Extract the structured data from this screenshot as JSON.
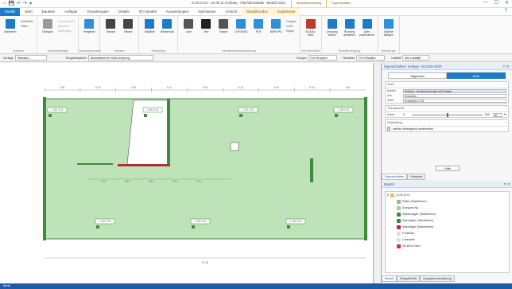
{
  "app": {
    "title": "2.OG.D.01 - 22 09 11 Archbau - Flachdeckstatik - Modell 2022",
    "context_tabs": [
      "Modellbearbeitung",
      "Eigenschaften"
    ]
  },
  "quick_access": [
    "⌂",
    "💾",
    "↶",
    "↷",
    "▾"
  ],
  "window_controls": [
    "—",
    "☐",
    "✕"
  ],
  "tabs": [
    {
      "label": "Modell",
      "active": true
    },
    {
      "label": "Start"
    },
    {
      "label": "Bauteile"
    },
    {
      "label": "Auflager"
    },
    {
      "label": "Einwirkungen"
    },
    {
      "label": "Details"
    },
    {
      "label": "IFC-Modell"
    },
    {
      "label": "Auswertungen"
    },
    {
      "label": "Nachweise"
    },
    {
      "label": "Ansicht"
    },
    {
      "label": "Modellmodus",
      "ctx": true
    },
    {
      "label": "Ergebnisse",
      "ctx": true
    }
  ],
  "help": "?",
  "ribbon": {
    "groups": [
      {
        "name": "Auswahl",
        "buttons": [
          {
            "label": "Markieren",
            "color": "#1e7bc8"
          }
        ],
        "small": [
          "Selektierte",
          "Filtern"
        ]
      },
      {
        "name": "Zwischenablage",
        "buttons": [
          {
            "label": "Einfügen",
            "color": "#9a9a9a"
          }
        ],
        "small": [
          "Ausschneiden",
          "Kopieren",
          "Übertragen"
        ]
      },
      {
        "name": "Ursprungsmodell",
        "buttons": [
          {
            "label": "Freigeben",
            "color": "#2f8fd8"
          }
        ],
        "small": []
      },
      {
        "name": "Messen",
        "buttons": [
          {
            "label": "Strecke",
            "color": "#444"
          },
          {
            "label": "Winkel",
            "color": "#444"
          }
        ],
        "small": []
      },
      {
        "name": "Bemaßung",
        "buttons": [
          {
            "label": "Maßlinie",
            "color": "#1e7bc8"
          },
          {
            "label": "Winkelmaß",
            "color": "#1e7bc8"
          }
        ],
        "small": []
      },
      {
        "name": "Arbeitsbereichsdarstellung",
        "buttons": [
          {
            "label": "Linie",
            "color": "#555"
          },
          {
            "label": "Text",
            "color": "#222"
          },
          {
            "label": "Raster",
            "color": "#555"
          },
          {
            "label": "DXF/DWG",
            "color": "#2f8fd8"
          },
          {
            "label": "PDF",
            "color": "#2f8fd8"
          },
          {
            "label": "BMP/JPG",
            "color": "#2f8fd8"
          }
        ],
        "small": [
          "Polygon",
          "Kreis",
          "Bogen"
        ]
      },
      {
        "name": "mb WorkSuite",
        "buttons": [
          {
            "label": "ViCADo-Sicht",
            "color": "#c0392b"
          }
        ],
        "small": []
      },
      {
        "name": "Modellerzeugung",
        "buttons": [
          {
            "label": "Ursprung setzen",
            "color": "#1e7bc8"
          },
          {
            "label": "Richtung definieren",
            "color": "#1e7bc8"
          },
          {
            "label": "Alles positionieren",
            "color": "#1e7bc8"
          }
        ],
        "small": []
      },
      {
        "name": "Werkzeuge",
        "buttons": [
          {
            "label": "Objekte ablegen",
            "color": "#2f8fd8"
          }
        ],
        "small": []
      }
    ]
  },
  "toolbar": {
    "vorlage_label": "Vorlage",
    "vorlage_value": "Standard",
    "eingabe_label": "Eingabesystem",
    "eingabe_value": "Automatisch im Sicht-Ursprung",
    "gruppe_label": "Gruppe",
    "gruppe_value": "Frei Gruppen",
    "situation_label": "Situation",
    "situation_value": "Frei Situation",
    "lastfall_label": "Lastfall",
    "lastfall_value": "alle Lastfälle"
  },
  "props": {
    "title": "Eigenschaften: Vorlage 'ViCADo-Sicht'",
    "tabs": [
      "Allgemein",
      "Sicht"
    ],
    "sicht_header": "Sicht",
    "rows": [
      {
        "k": "Modell",
        "v": "Rohbau - Architekturmodell mit Rohbau"
      },
      {
        "k": "Zus.",
        "v": "Grundriss"
      },
      {
        "k": "Sicht",
        "v": "Draufsicht 2.OG"
      }
    ],
    "transparenz_header": "Transparenz",
    "anteil_label": "Anteil",
    "anteil_min": "0",
    "anteil_max": "100",
    "anteil_val": "50",
    "anteil_unit": "%",
    "darstellung_header": "Darstellung",
    "hintergrund": "weißen Hintergrund ausblenden",
    "hilfe": "Hilfe",
    "bottom_tabs": [
      "Eigenschaften",
      "Hinweise"
    ]
  },
  "model": {
    "title": "Modell",
    "root": "2.OG.D.01",
    "items": [
      {
        "label": "Platte (Stahlbeton)",
        "color": "#7fc97f"
      },
      {
        "label": "Aussparung",
        "color": "#bbb"
      },
      {
        "label": "Stützenlager (Stahlbeton)",
        "color": "#3d8b3d"
      },
      {
        "label": "Wandlager (Stahlbeton)",
        "color": "#3d8b3d"
      },
      {
        "label": "Wandlager (Mauerwerk)",
        "color": "#b03030"
      },
      {
        "label": "Punktlast",
        "color": "#ddd"
      },
      {
        "label": "Linienlast",
        "color": "#ddd"
      },
      {
        "label": "ViCADo-Sicht",
        "color": "#c0392b"
      }
    ],
    "bottom_tabs": [
      "Modell",
      "Eingabehilfe",
      "Ausgabenverwaltung"
    ]
  },
  "drawing": {
    "top_dims": [
      "3.51",
      "6.13",
      "6.90",
      "6.10",
      "6.10",
      "6.10",
      "6.00",
      "6.10",
      "3.51"
    ],
    "total_dim": "37.18",
    "mid_dims": [
      "2.00",
      "3.60",
      "1.82",
      "4.00",
      "2.40"
    ],
    "column_labels": [
      "1 200 S 51",
      "1 200 S 51",
      "1 200 S 51",
      "1 200 S 51",
      "1 200 S 51",
      "1 200 S 51",
      "1 200 S 51"
    ]
  },
  "status_text": "Bereit"
}
